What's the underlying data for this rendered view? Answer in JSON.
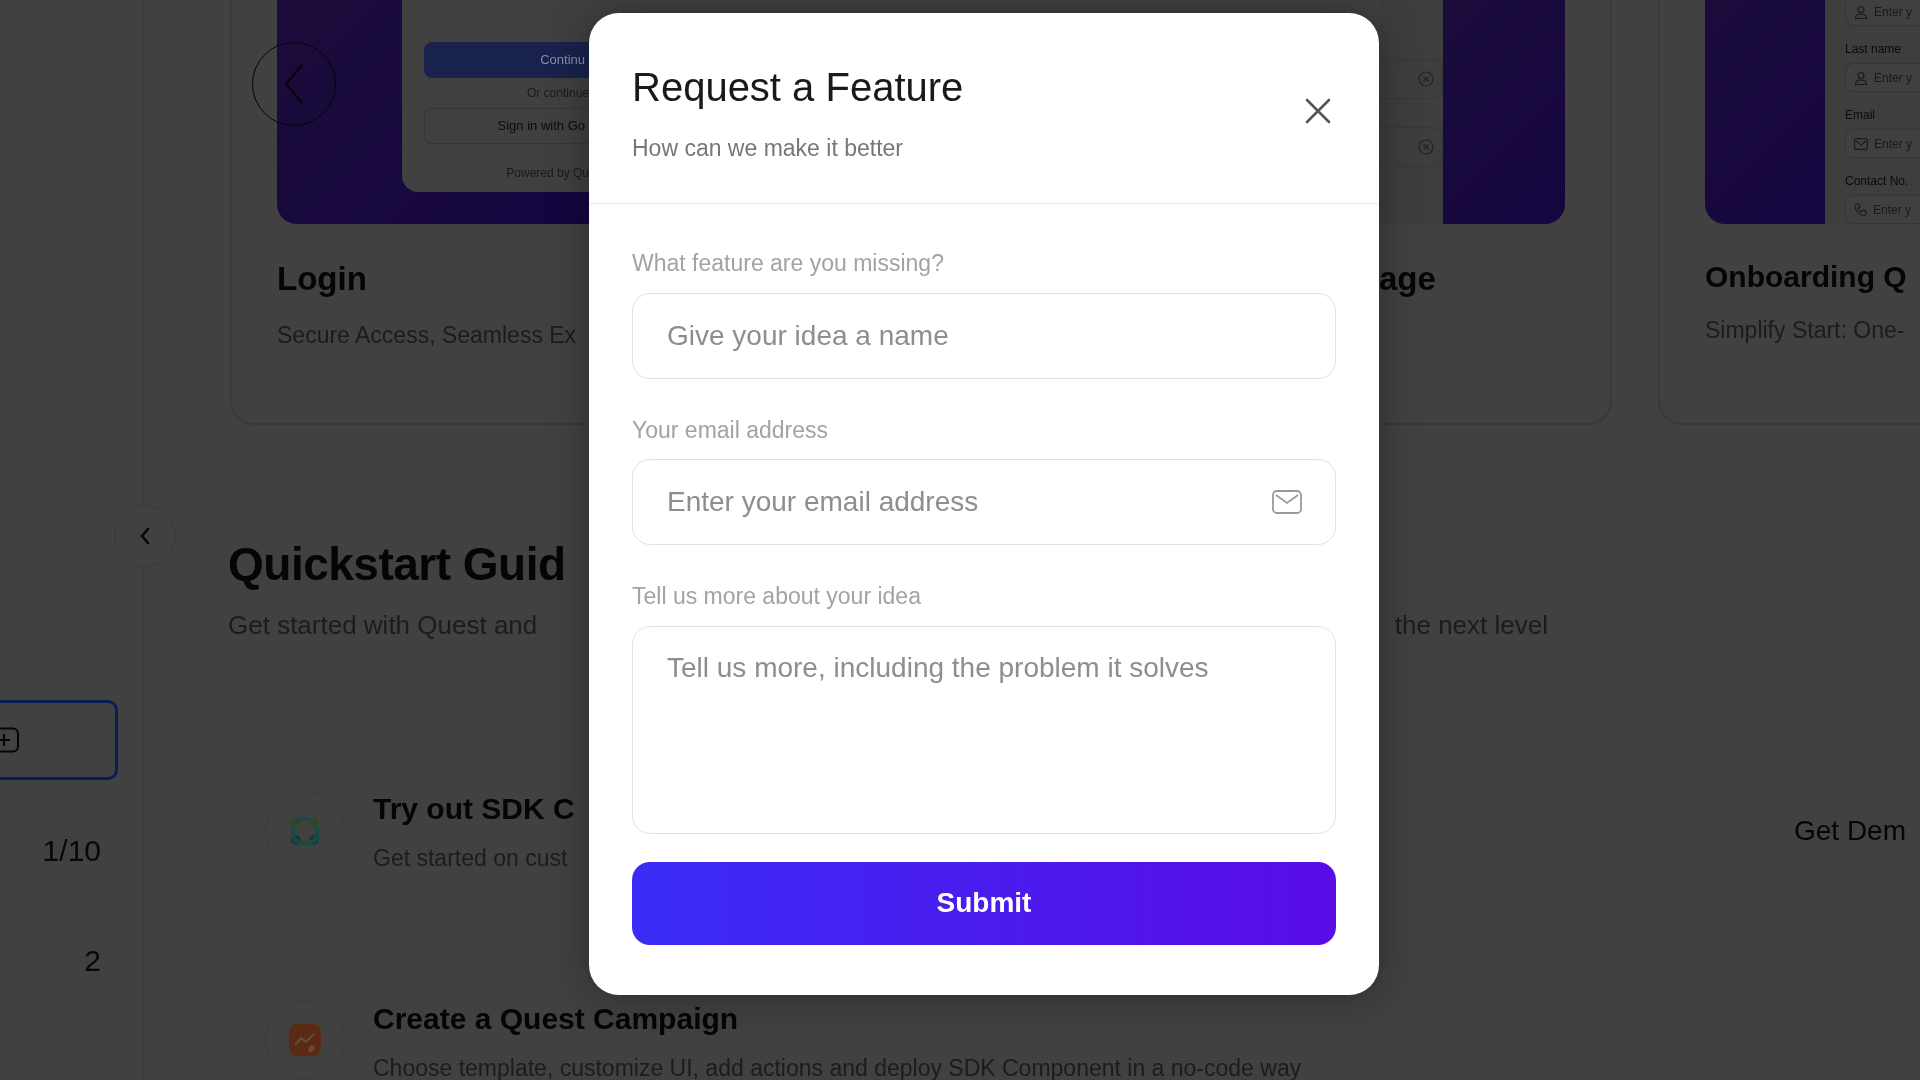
{
  "sidebar": {
    "items": [
      {
        "kind": "icon",
        "selected": true
      },
      {
        "kind": "text",
        "label": "1/10",
        "selected": false
      },
      {
        "kind": "text",
        "label": "2",
        "selected": false
      }
    ]
  },
  "template_cards": [
    {
      "title": "Login",
      "subtitle": "Secure Access, Seamless Ex",
      "preview": {
        "kind": "login",
        "primary_button": "Continu",
        "divider_text": "Or continue",
        "secondary_button": "Sign in with Go",
        "footer": "Powered by Qu"
      }
    },
    {
      "title": "age",
      "preview": {
        "kind": "clear-fields"
      }
    },
    {
      "title": "Onboarding Q",
      "subtitle": "Simplify Start: One-",
      "preview": {
        "kind": "form",
        "fields": [
          {
            "kind": "user",
            "placeholder": "Enter y"
          },
          {
            "kind": "user",
            "label": "Last name",
            "placeholder": "Enter y"
          },
          {
            "kind": "mail",
            "label": "Email",
            "placeholder": "Enter y"
          },
          {
            "kind": "phone",
            "label": "Contact No.",
            "placeholder": "Enter y"
          }
        ]
      }
    }
  ],
  "quickstart": {
    "title": "Quickstart Guid",
    "subtitle_left": "Get started with Quest and",
    "subtitle_right": "the next level",
    "items": [
      {
        "kind": "sdk",
        "title": "Try out SDK C",
        "description": "Get started on cust",
        "action": "Get Dem"
      },
      {
        "kind": "campaign",
        "title": "Create a Quest Campaign",
        "description": "Choose template, customize UI, add actions and deploy SDK Component in a no-code way"
      }
    ]
  },
  "modal": {
    "title": "Request a Feature",
    "subtitle": "How can we make it better",
    "fields": [
      {
        "kind": "input",
        "label": "What feature are you missing?",
        "placeholder": "Give your idea a name"
      },
      {
        "kind": "email",
        "label": "Your email address",
        "placeholder": "Enter your email address"
      },
      {
        "kind": "textarea",
        "label": "Tell us more about your idea",
        "placeholder": "Tell us more, including the problem it solves"
      }
    ],
    "submit": "Submit"
  }
}
